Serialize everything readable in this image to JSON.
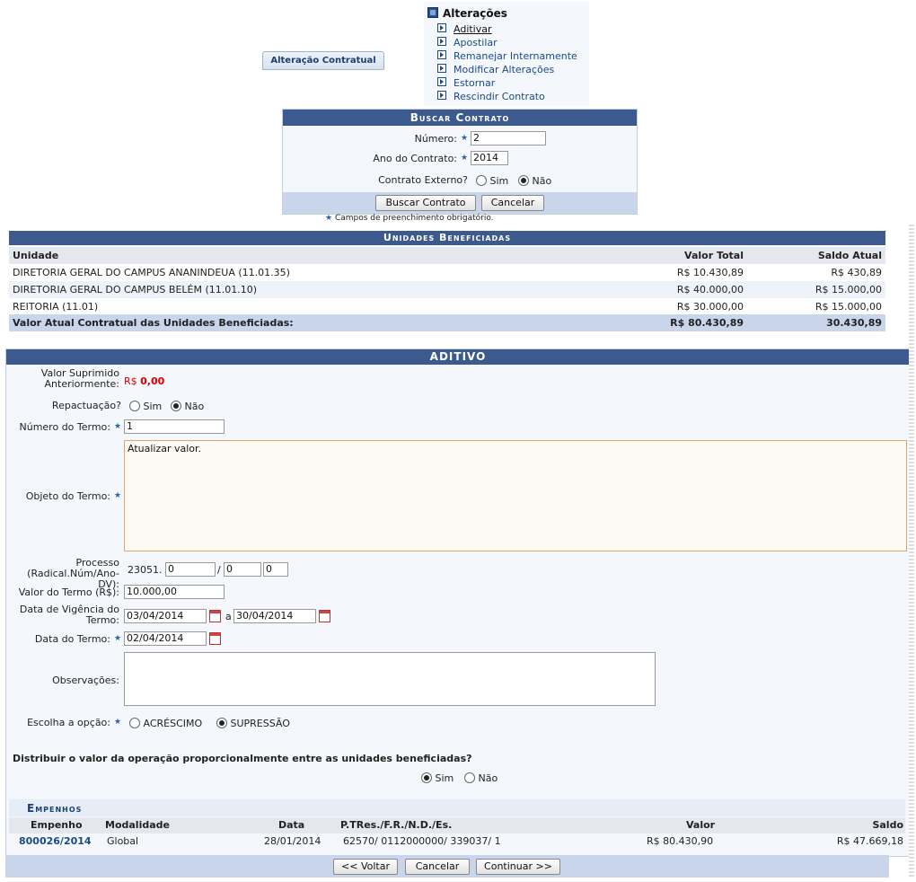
{
  "menu": {
    "title": "Alterações",
    "items": [
      "Aditivar",
      "Apostilar",
      "Remanejar Internamente",
      "Modificar Alterações",
      "Estornar",
      "Rescindir Contrato"
    ]
  },
  "tab": {
    "label": "Alteração Contratual"
  },
  "buscar": {
    "title": "Buscar Contrato",
    "numero_label": "Número:",
    "numero_value": "2",
    "ano_label": "Ano do Contrato:",
    "ano_value": "2014",
    "externo_label": "Contrato Externo?",
    "sim": "Sim",
    "nao": "Não",
    "buscar_btn": "Buscar Contrato",
    "cancelar_btn": "Cancelar",
    "obrigatorio": "Campos de preenchimento obrigatório."
  },
  "unidades": {
    "title": "Unidades Beneficiadas",
    "headers": [
      "Unidade",
      "Valor Total",
      "Saldo Atual"
    ],
    "rows": [
      [
        "DIRETORIA GERAL DO CAMPUS ANANINDEUA (11.01.35)",
        "R$ 10.430,89",
        "R$ 430,89"
      ],
      [
        "DIRETORIA GERAL DO CAMPUS BELÉM (11.01.10)",
        "R$ 40.000,00",
        "R$ 15.000,00"
      ],
      [
        "REITORIA (11.01)",
        "R$ 30.000,00",
        "R$ 15.000,00"
      ]
    ],
    "footer": [
      "Valor Atual Contratual das Unidades Beneficiadas:",
      "R$ 80.430,89",
      "30.430,89"
    ]
  },
  "aditivo": {
    "title": "ADITIVO",
    "valor_suprimido_label1": "Valor Suprimido",
    "valor_suprimido_label2": "Anteriormente:",
    "valor_suprimido_currency": "R$",
    "valor_suprimido_value": "0,00",
    "repactuacao_label": "Repactuação?",
    "sim": "Sim",
    "nao": "Não",
    "numero_termo_label": "Número do Termo:",
    "numero_termo_value": "1",
    "objeto_label": "Objeto do Termo:",
    "objeto_value": "Atualizar valor.",
    "processo_label1": "Processo",
    "processo_label2": "(Radical.Núm/Ano-DV):",
    "processo_radical": "23051.",
    "processo_num": "0",
    "processo_sep": "/",
    "processo_ano": "0",
    "processo_dv": "0",
    "valor_termo_label": "Valor do Termo (R$):",
    "valor_termo_value": "10.000,00",
    "vigencia_label1": "Data de Vigência do",
    "vigencia_label2": "Termo:",
    "vigencia_inicio": "03/04/2014",
    "vigencia_sep": "a",
    "vigencia_fim": "30/04/2014",
    "data_termo_label": "Data do Termo:",
    "data_termo_value": "02/04/2014",
    "observacoes_label": "Observações:",
    "opcao_label": "Escolha a opção:",
    "acrescimo": "ACRÉSCIMO",
    "supressao": "SUPRESSÃO",
    "distribuir_question": "Distribuir o valor da operação proporcionalmente entre as unidades beneficiadas?"
  },
  "empenhos": {
    "title": "Empenhos",
    "headers": [
      "Empenho",
      "Modalidade",
      "Data",
      "P.TRes./F.R./N.D./Es.",
      "Valor",
      "Saldo"
    ],
    "rows": [
      [
        "800026/2014",
        "Global",
        "28/01/2014",
        "62570/ 0112000000/ 339037/ 1",
        "R$ 80.430,90",
        "R$ 47.669,18"
      ]
    ]
  },
  "actions": {
    "voltar": "<< Voltar",
    "cancelar": "Cancelar",
    "continuar": "Continuar >>"
  },
  "colors": {
    "header_blue": "#3d5a8e",
    "link": "#1a4a8a",
    "red_value": "#d40000"
  }
}
